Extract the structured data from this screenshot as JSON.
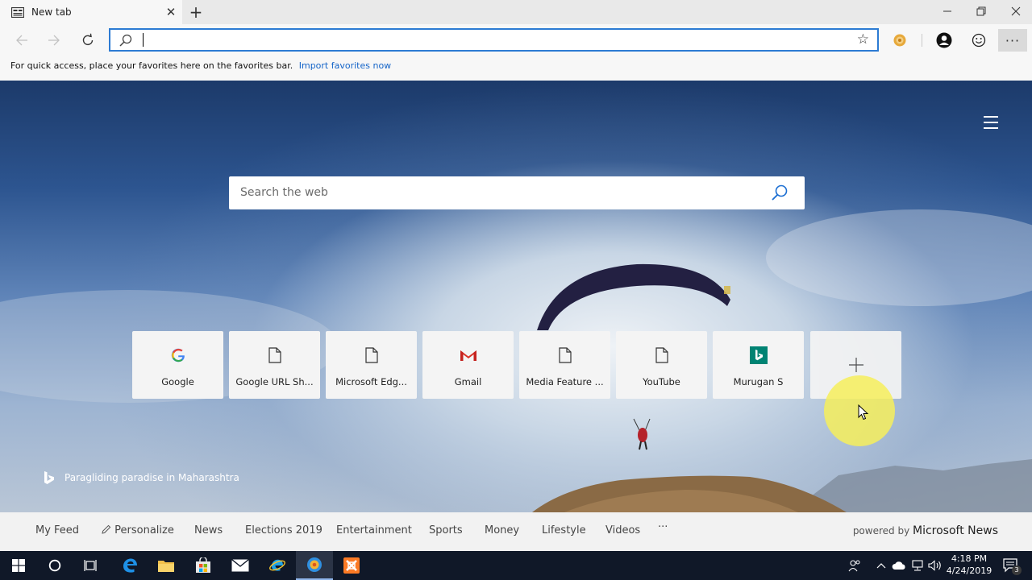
{
  "browser": {
    "tab_title": "New tab",
    "address_value": "",
    "favorites_hint": "For quick access, place your favorites here on the favorites bar.",
    "favorites_link": "Import favorites now"
  },
  "newtab": {
    "search_placeholder": "Search the web",
    "tiles": [
      {
        "label": "Google",
        "icon": "google-icon"
      },
      {
        "label": "Google URL Sh...",
        "icon": "page-icon"
      },
      {
        "label": "Microsoft Edg...",
        "icon": "page-icon"
      },
      {
        "label": "Gmail",
        "icon": "gmail-icon"
      },
      {
        "label": "Media Feature ...",
        "icon": "page-icon"
      },
      {
        "label": "YouTube",
        "icon": "page-icon"
      },
      {
        "label": "Murugan S",
        "icon": "bing-icon"
      },
      {
        "label": "",
        "icon": "plus-icon"
      }
    ],
    "image_credit": "Paragliding paradise in Maharashtra"
  },
  "feed": {
    "items": [
      "My Feed",
      "Personalize",
      "News",
      "Elections 2019",
      "Entertainment",
      "Sports",
      "Money",
      "Lifestyle",
      "Videos",
      "···"
    ],
    "powered_by": "powered by",
    "provider": "Microsoft News"
  },
  "taskbar": {
    "time": "4:18 PM",
    "date": "4/24/2019",
    "notification_count": "3"
  },
  "colors": {
    "accent": "#2c7bd3",
    "link": "#1464c8",
    "taskbar": "#101828"
  }
}
